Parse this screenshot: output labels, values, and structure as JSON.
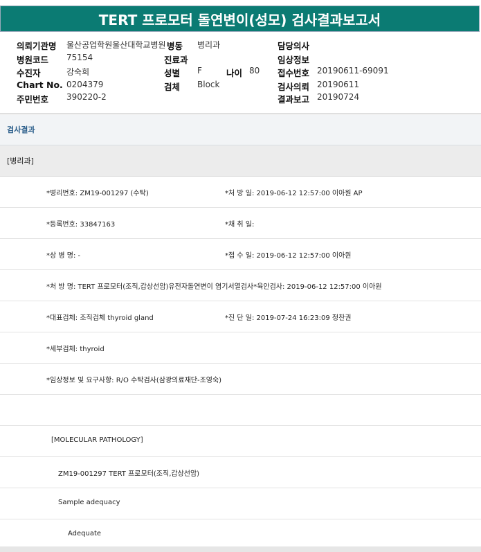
{
  "header": {
    "title": "TERT 프로모터 돌연변이(성모) 검사결과보고서"
  },
  "info": {
    "institution_label": "의뢰기관명",
    "institution_value": "울산공업학원울산대학교병원",
    "ward_label": "병동",
    "ward_value": "병리과",
    "doctor_label": "담당의사",
    "hospital_code_label": "병원코드",
    "hospital_code_value": "75154",
    "department_label": "진료과",
    "clinical_info_label": "임상정보",
    "patient_label": "수진자",
    "patient_value": "강숙희",
    "sex_label": "성별",
    "sex_value": "F",
    "age_label": "나이",
    "age_value": "80",
    "receipt_no_label": "접수번호",
    "receipt_no_value": "20190611-69091",
    "chart_label": "Chart No.",
    "chart_value": "0204379",
    "specimen_label": "검체",
    "specimen_value": "Block",
    "request_label": "검사의뢰",
    "request_value": "20190611",
    "resident_label": "주민번호",
    "resident_value": "390220-2",
    "report_label": "결과보고",
    "report_value": "20190724"
  },
  "results": {
    "section_title": "검사결과",
    "department": "[병리과]",
    "rows": [
      {
        "left": "*병리번호: ZM19-001297 (수탁)",
        "right": "*처 방 일: 2019-06-12 12:57:00  이아원 AP"
      },
      {
        "left": "*등록번호: 33847163",
        "right": "*채 취 일:"
      },
      {
        "left": "*상 병 명: -",
        "right": "*접 수 일: 2019-06-12 12:57:00  이아원"
      },
      {
        "left": "*처 방 명: TERT 프로모터(조직,갑상선암)유전자돌연변이 염기서열검사*육안검사: 2019-06-12 12:57:00  이아원",
        "right": ""
      },
      {
        "left": "*대표검체: 조직검체 thyroid gland",
        "right": "*진 단 일: 2019-07-24 16:23:09  정찬권"
      },
      {
        "left": "*세부검체: thyroid",
        "right": ""
      },
      {
        "left": "*임상정보 및 요구사항: R/O 수탁검사(삼광의료재단-조영숙)",
        "right": ""
      },
      {
        "left": "",
        "right": ""
      },
      {
        "left": "[MOLECULAR PATHOLOGY]",
        "right": ""
      },
      {
        "left": "ZM19-001297      TERT 프로모터(조직,갑상선암)",
        "right": ""
      },
      {
        "left": "Sample adequacy",
        "right": ""
      },
      {
        "left": "Adequate",
        "right": ""
      }
    ]
  }
}
